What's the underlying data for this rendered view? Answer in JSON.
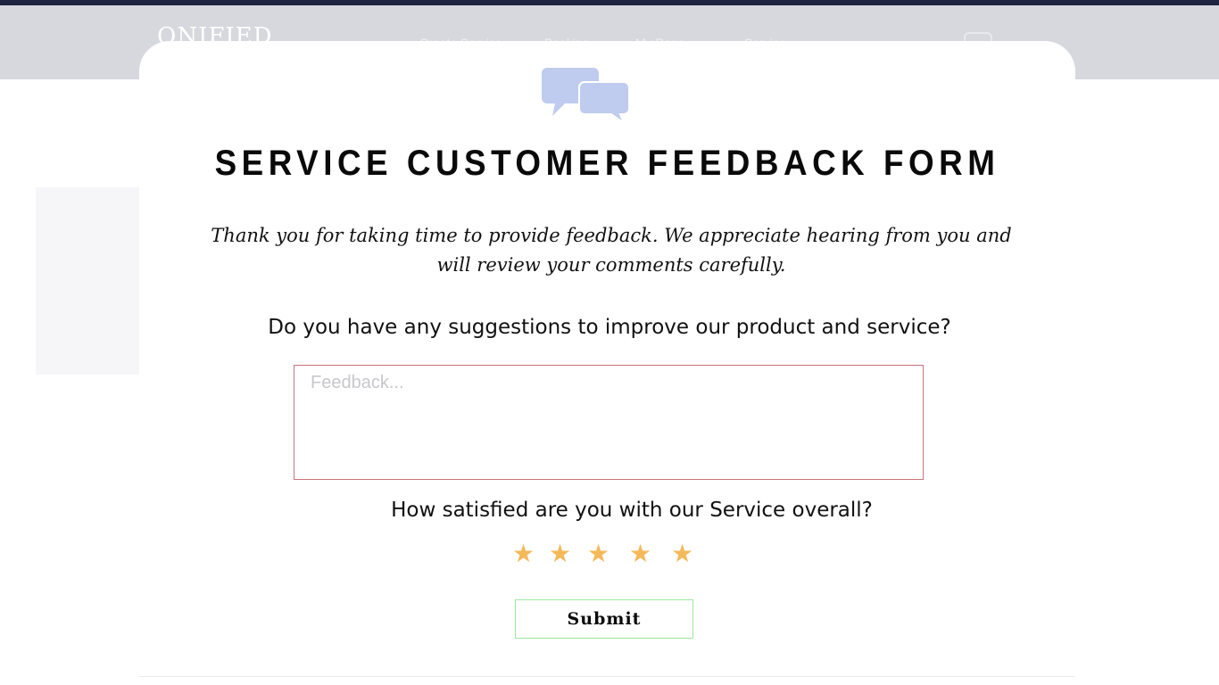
{
  "site": {
    "logo": "ONIFIED",
    "nav": [
      "Create Service",
      "Booking",
      "My Page",
      "Service"
    ]
  },
  "form": {
    "title": "SERVICE CUSTOMER FEEDBACK FORM",
    "intro": "Thank you for taking time to provide feedback. We appreciate hearing from you and will review your comments carefully.",
    "suggestion_question": "Do you have any suggestions to improve our product and service?",
    "feedback_placeholder": "Feedback...",
    "feedback_value": "",
    "satisfaction_question": "How satisfied are you with our Service overall?",
    "rating": {
      "max": 5,
      "star_glyph": "★",
      "color": "#f5b95a"
    },
    "submit_label": "Submit"
  },
  "colors": {
    "accent_icon": "#bfcbef",
    "header_bg": "#d7d8de",
    "top_strip": "#1f2440",
    "feedback_border": "#c9737a",
    "submit_border": "#9be89b"
  },
  "icons": {
    "chat": "speech-bubbles-icon"
  }
}
